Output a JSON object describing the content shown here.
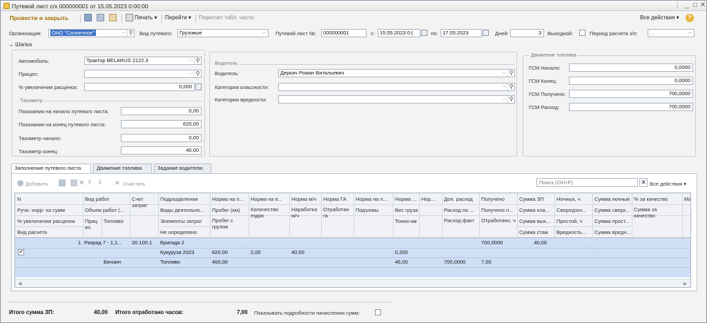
{
  "window": {
    "title": "Путевой лист с/х 000000001 от 15.05.2023 0:00:00"
  },
  "toolbar": {
    "post_close": "Провести и закрыть",
    "print": "Печать",
    "goto": "Перейти",
    "recalc": "Пересчет табл. части",
    "all_actions": "Все действия"
  },
  "header": {
    "org_label": "Организация:",
    "org_value": "ОАО \"Солнечное\"",
    "kind_label": "Вид путевого:",
    "kind_value": "Грузовые",
    "num_label": "Путевой лист №:",
    "num_value": "000000001",
    "from_label": "с:",
    "from_value": "15.05.2023  0:(",
    "to_label": "по:",
    "to_value": "17.05.2023",
    "days_label": "Дней:",
    "days_value": "3",
    "weekend_label": "Выходной:",
    "period_label": "Период расчета з/п:",
    "period_value": ". ."
  },
  "section": {
    "title": "Шапка"
  },
  "left": {
    "auto_label": "Автомобиль:",
    "auto_value": "Трактор BELARUS 2122.3",
    "trailer_label": "Прицеп:",
    "trailer_value": "",
    "rate_label": "% увеличения расценок:",
    "rate_value": "0,000",
    "taco_title": "Тахометр",
    "start_label": "Показания на начало путевого листа:",
    "start_value": "0,00",
    "end_label": "Показания на конец путевого листа:",
    "end_value": "620,00",
    "tstart_label": "Тахометр начало:",
    "tstart_value": "0,00",
    "tend_label": "Тахометр конец:",
    "tend_value": "40,00"
  },
  "driver": {
    "group_title": "Водитель",
    "driver_label": "Водитель:",
    "driver_value": "Деркач Роман Витальевич",
    "class_label": "Категория классности:",
    "class_value": "",
    "harm_label": "Категория вредности:",
    "harm_value": ""
  },
  "fuel": {
    "group_title": "Движение топлива",
    "start_label": "ГСМ Начало:",
    "start_value": "0,0000",
    "end_label": "ГСМ Конец:",
    "end_value": "0,0000",
    "received_label": "ГСМ Получено:",
    "received_value": "700,0000",
    "spent_label": "ГСМ Расход:",
    "spent_value": "700,0000"
  },
  "tabs": [
    "Заполнение путевого листа",
    "Движение топлива",
    "Задание водителю"
  ],
  "grid_toolbar": {
    "add": "Добавить",
    "clear": "Очистить",
    "search_placeholder": "Поиск (Ctrl+F)",
    "all_actions": "Все действия"
  },
  "grid": {
    "headers": {
      "n1": "N",
      "n2": "Ручн. корр- ка сумм",
      "n3": "% увеличения расценок",
      "n4": "Вид расчета",
      "work1": "Вид работ",
      "work2": "Объем работ (...",
      "work3a": "Приц еп",
      "work3b": "Топливо",
      "acc": "Счет затрат",
      "dep1": "Подразделения",
      "dep2": "Виды деятельно...",
      "dep3": "Элементы затрат",
      "dep4": "Не определено",
      "nk1": "Норма на п...",
      "nk2": "Пробег (км)",
      "nk3": "Пробег с грузом",
      "ne1": "Норма на е...",
      "ne2": "Количество ездок",
      "nm1": "Норма м/ч",
      "nm2": "Наработка м/ч",
      "ga1": "Норма ГА",
      "ga2": "Отработан га",
      "np1": "Норма на п...",
      "np2": "Подъемы",
      "nn1": "Норма ...",
      "nn2": "Вес груза",
      "nn3": "Тонно-км",
      "nr1": "Нор...",
      "dr1": "Доп. расход",
      "dr2": "Расход по ...",
      "dr3": "Расход факт",
      "rc1": "Получено",
      "rc2": "Получено п...",
      "rc3": "Отработано, ч",
      "sz1": "Сумма ЗП",
      "sz2": "Сумма кла...",
      "sz3": "Сумма вых...",
      "sz4": "Сумма стаж",
      "nt1": "Ночных, ч",
      "nt2": "Сверхуроч...",
      "nt3": "Простой, ч",
      "nt4": "Вредность...",
      "sn1": "Сумма ночные",
      "sn2": "Сумма сверх...",
      "sn3": "Сумма прост...",
      "sn4": "Сумма вредн...",
      "q1": "% за качество",
      "q2": "Сумма за качество",
      "ma": "Ма"
    },
    "rows": {
      "r1_n": "1",
      "r1_work": "Разряд 7 - 1,1...",
      "r1_acc": "20.100.1",
      "r1_dep": "Бригада 2",
      "r1_received": "700,0000",
      "r1_sumzp": "40,00",
      "r2_dep": "Кукуруза 2023",
      "r2_km": "620,00",
      "r2_trips": "2,00",
      "r2_mh": "40,00",
      "r2_weight": "0,200",
      "r3_fuel": "Бензин",
      "r3_dep": "Топливо",
      "r3_km": "460,00",
      "r3_tkm": "46,00",
      "r3_fact": "700,0000",
      "r3_hours": "7,00"
    }
  },
  "footer": {
    "sum_label": "Итого сумма ЗП:",
    "sum_value": "40,00",
    "hours_label": "Итого отработано часов:",
    "hours_value": "7,00",
    "details_label": "Показывать подробности начисления сумм:"
  },
  "colors": {
    "accent": "#a06d00",
    "selection": "#3b71c6",
    "row_selected": "#cfe0f6"
  }
}
